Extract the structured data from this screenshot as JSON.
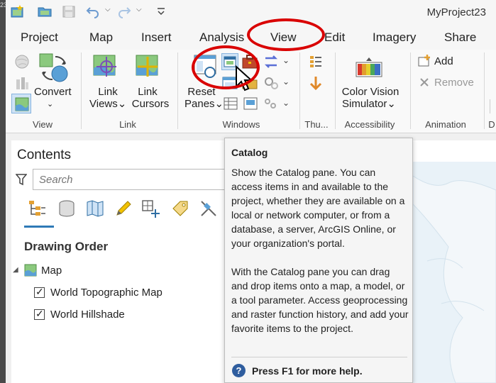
{
  "app": {
    "project_title": "MyProject23",
    "left_strip_text": "23"
  },
  "tabs": [
    {
      "label": "Project"
    },
    {
      "label": "Map"
    },
    {
      "label": "Insert"
    },
    {
      "label": "Analysis"
    },
    {
      "label": "View",
      "active": true
    },
    {
      "label": "Edit"
    },
    {
      "label": "Imagery"
    },
    {
      "label": "Share"
    }
  ],
  "ribbon": {
    "view_group": {
      "label": "View",
      "convert_label": "Convert"
    },
    "link_group": {
      "label": "Link",
      "link_views_line1": "Link",
      "link_views_line2": "Views",
      "link_cursors_line1": "Link",
      "link_cursors_line2": "Cursors"
    },
    "windows_group": {
      "label": "Windows",
      "reset_panes_line1": "Reset",
      "reset_panes_line2": "Panes"
    },
    "thumbnail_group": {
      "label": "Thu..."
    },
    "accessibility_group": {
      "label": "Accessibility",
      "cvs_line1": "Color Vision",
      "cvs_line2": "Simulator"
    },
    "animation_group": {
      "label": "Animation",
      "add_label": "Add",
      "remove_label": "Remove"
    },
    "cut_off_label": "D"
  },
  "contents": {
    "title": "Contents",
    "search_placeholder": "Search",
    "section_title": "Drawing Order",
    "map_item": "Map",
    "layers": [
      {
        "label": "World Topographic Map",
        "checked": true
      },
      {
        "label": "World Hillshade",
        "checked": true
      }
    ]
  },
  "tooltip": {
    "title": "Catalog",
    "paragraph1": "Show the Catalog pane. You can access items in and available to the project, whether they are available on a local or network computer, or from a database, a server, ArcGIS Online, or your organization's portal.",
    "paragraph2": "With the Catalog pane you can drag and drop items onto a map, a model, or a tool parameter. Access geoprocessing and raster function history, and add your favorite items to the project.",
    "help_text": "Press F1 for more help."
  },
  "colors": {
    "annotation_red": "#d90000",
    "accent_blue": "#2f7ab7",
    "help_blue": "#2f5d9e"
  }
}
